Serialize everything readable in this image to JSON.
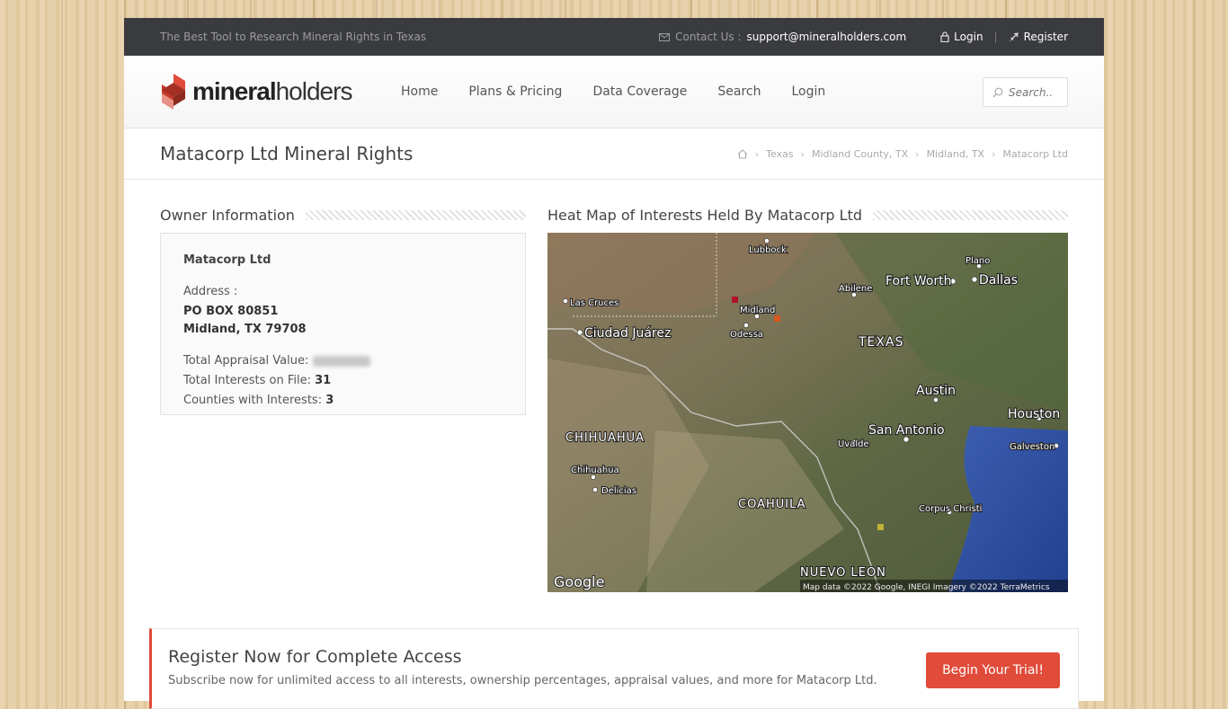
{
  "topbar": {
    "tagline": "The Best Tool to Research Mineral Rights in Texas",
    "contact_label": "Contact Us :",
    "email": "support@mineralholders.com",
    "login": "Login",
    "register": "Register"
  },
  "logo": {
    "bold": "mineral",
    "light": "holders"
  },
  "nav": [
    "Home",
    "Plans & Pricing",
    "Data Coverage",
    "Search",
    "Login"
  ],
  "search": {
    "placeholder": "Search.."
  },
  "page": {
    "title": "Matacorp Ltd Mineral Rights",
    "breadcrumb": [
      "Texas",
      "Midland County, TX",
      "Midland, TX",
      "Matacorp Ltd"
    ]
  },
  "owner": {
    "heading": "Owner Information",
    "name": "Matacorp Ltd",
    "address_label": "Address :",
    "address_line1": "PO BOX 80851",
    "address_line2": "Midland, TX 79708",
    "appraisal_label": "Total Appraisal Value:",
    "interests_label": "Total Interests on File:",
    "interests_value": "31",
    "counties_label": "Counties with Interests:",
    "counties_value": "3"
  },
  "map": {
    "heading": "Heat Map of Interests Held By Matacorp Ltd",
    "labels": {
      "lubbock": "Lubbock",
      "plano": "Plano",
      "dallas": "Dallas",
      "fort_worth": "Fort Worth",
      "abilene": "Abilene",
      "las_cruces": "Las Cruces",
      "midland": "Midland",
      "odessa": "Odessa",
      "ciudad_juarez": "Ciudad Juárez",
      "texas": "TEXAS",
      "austin": "Austin",
      "houston": "Houston",
      "san_antonio": "San Antonio",
      "uvalde": "Uvalde",
      "galveston": "Galveston",
      "chihuahua_state": "CHIHUAHUA",
      "chihuahua": "Chihuahua",
      "delicias": "Delicias",
      "coahuila": "COAHUILA",
      "corpus_christi": "Corpus Christi",
      "nuevo_leon": "NUEVO LEON"
    },
    "google": "Google",
    "attribution": "Map data ©2022 Google, INEGI Imagery ©2022 TerraMetrics"
  },
  "banner": {
    "title": "Register Now for Complete Access",
    "text": "Subscribe now for unlimited access to all interests, ownership percentages, appraisal values, and more for Matacorp Ltd.",
    "button": "Begin Your Trial!"
  },
  "colors": {
    "accent": "#e04b3a",
    "topbar": "#3a3b3f"
  }
}
